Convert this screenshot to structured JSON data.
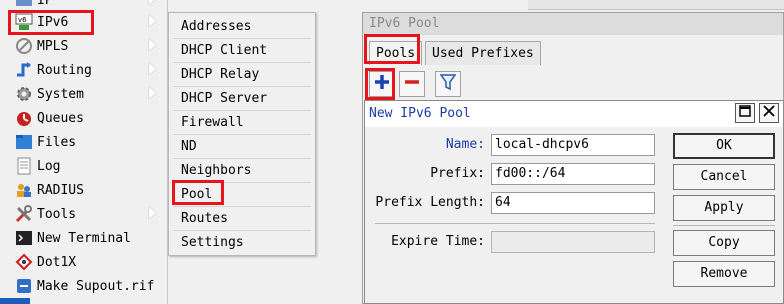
{
  "left_menu": {
    "items": [
      {
        "label": "IP",
        "icon": "ip-icon",
        "has_submenu": true
      },
      {
        "label": "IPv6",
        "icon": "ipv6-icon",
        "has_submenu": true
      },
      {
        "label": "MPLS",
        "icon": "mpls-icon",
        "has_submenu": true
      },
      {
        "label": "Routing",
        "icon": "routing-icon",
        "has_submenu": true
      },
      {
        "label": "System",
        "icon": "system-gear-icon",
        "has_submenu": true
      },
      {
        "label": "Queues",
        "icon": "queues-icon",
        "has_submenu": false
      },
      {
        "label": "Files",
        "icon": "files-icon",
        "has_submenu": false
      },
      {
        "label": "Log",
        "icon": "log-icon",
        "has_submenu": false
      },
      {
        "label": "RADIUS",
        "icon": "radius-icon",
        "has_submenu": false
      },
      {
        "label": "Tools",
        "icon": "tools-icon",
        "has_submenu": true
      },
      {
        "label": "New Terminal",
        "icon": "terminal-icon",
        "has_submenu": false
      },
      {
        "label": "Dot1X",
        "icon": "dot1x-icon",
        "has_submenu": false
      },
      {
        "label": "Make Supout.rif",
        "icon": "supout-icon",
        "has_submenu": false
      }
    ]
  },
  "submenu": {
    "items": [
      "Addresses",
      "DHCP Client",
      "DHCP Relay",
      "DHCP Server",
      "Firewall",
      "ND",
      "Neighbors",
      "Pool",
      "Routes",
      "Settings"
    ]
  },
  "pool_window": {
    "title": "IPv6 Pool",
    "tabs": [
      "Pools",
      "Used Prefixes"
    ],
    "toolbar": {
      "add_icon": "plus-icon",
      "remove_icon": "minus-icon",
      "filter_icon": "filter-icon"
    }
  },
  "dialog": {
    "title": "New IPv6 Pool",
    "fields": {
      "name_label": "Name:",
      "name_value": "local-dhcpv6",
      "prefix_label": "Prefix:",
      "prefix_value": "fd00::/64",
      "prefix_length_label": "Prefix Length:",
      "prefix_length_value": "64",
      "expire_time_label": "Expire Time:",
      "expire_time_value": ""
    },
    "buttons": {
      "ok": "OK",
      "cancel": "Cancel",
      "apply": "Apply",
      "copy": "Copy",
      "remove": "Remove"
    }
  },
  "colors": {
    "highlight": "#e8141c",
    "dialog_title": "#1a3da8",
    "name_label": "#1a3da8",
    "add_icon": "#1840b0",
    "remove_icon": "#d42020"
  }
}
